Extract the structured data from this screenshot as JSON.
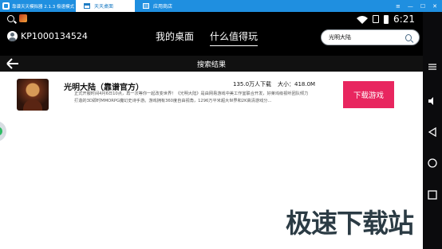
{
  "window": {
    "title": "靠谱天天模拟器 2.1.3 极速模式",
    "tabs": [
      {
        "label": "天天桌面",
        "active": true
      },
      {
        "label": "应用商店",
        "active": false
      }
    ],
    "controls": [
      "≡",
      "—",
      "☐",
      "✕"
    ]
  },
  "status": {
    "time": "6:21"
  },
  "header": {
    "user_id": "KP1000134524",
    "nav": [
      {
        "label": "我的桌面",
        "active": false
      },
      {
        "label": "什么值得玩",
        "active": true
      }
    ],
    "search_value": "光明大陆"
  },
  "results": {
    "title": "搜索结果",
    "items": [
      {
        "name": "光明大陆（靠谱官方）",
        "downloads": "135.0万人下载",
        "size": "大小：418.0M",
        "description": "正式开服时间4月6日10点，再一次等你一起改变世界！《光明大陆》是由网易游戏中美工作室联合开发，好莱坞级视听团队倾力打造的3D即时MMORPG魔幻史诗手游。游戏拥有360度自由视角，1296万平米超大世界和2K高清游戏分...",
        "button": "下载游戏"
      }
    ]
  },
  "watermark": "极速下载站",
  "colors": {
    "titlebar": "#1f8fe0",
    "download_button": "#e8265f",
    "header_bg": "#000000"
  }
}
